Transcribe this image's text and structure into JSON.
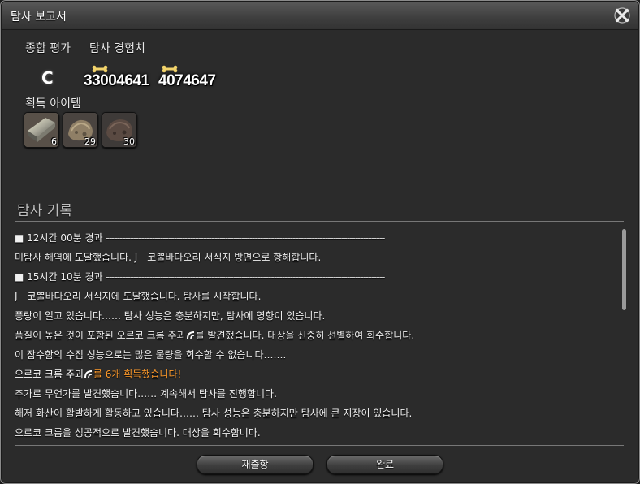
{
  "window": {
    "title": "탐사 보고서"
  },
  "summary": {
    "overall_label": "종합 평가",
    "exp_label": "탐사 경험치",
    "grade": "C",
    "exp_value": "33004641",
    "bonus_value": "4074647"
  },
  "items_label": "획득 아이템",
  "items": [
    {
      "name": "ingot",
      "count": "6"
    },
    {
      "name": "ore",
      "count": "29"
    },
    {
      "name": "dark-ore",
      "count": "30"
    }
  ],
  "log": {
    "title": "탐사 기록",
    "lines": [
      {
        "text": "■ 12시간 00분 경과",
        "dashes": "-------------------------------------------------------------------------------------------------------"
      },
      {
        "text": "미탐사 해역에 도달했습니다. J　코뿔바다오리 서식지 방면으로 항해합니다."
      },
      {
        "text": "■ 15시간 10분 경과",
        "dashes": "-------------------------------------------------------------------------------------------------------"
      },
      {
        "text": "J　코뿔바다오리 서식지에 도달했습니다. 탐사를 시작합니다."
      },
      {
        "text": "풍랑이 일고 있습니다…… 탐사 성능은 충분하지만, 탐사에 영향이 있습니다."
      },
      {
        "text": "품질이 높은 것이 포함된 오르코 크롬 주괴",
        "suffix": "를 발견했습니다. 대상을 신중히 선별하여 회수합니다."
      },
      {
        "text": "이 잠수함의 수집 성능으로는 많은 물량을 회수할 수 없습니다……."
      },
      {
        "text": "오르코 크롬 주괴",
        "suffix": "를 6개 획득했습니다!"
      },
      {
        "text": "추가로 무언가를 발견했습니다…… 계속해서 탐사를 진행합니다."
      },
      {
        "text": "해저 화산이 활발하게 활동하고 있습니다…… 탐사 성능은 충분하지만 탐사에 큰 지장이 있습니다."
      },
      {
        "text": "오르코 크롬을 성공적으로 발견했습니다. 대상을 회수합니다."
      }
    ]
  },
  "buttons": {
    "resubmit": "재출항",
    "done": "완료"
  },
  "colors": {
    "highlight": "#ff9a2a",
    "panel": "#2b2b2b"
  }
}
